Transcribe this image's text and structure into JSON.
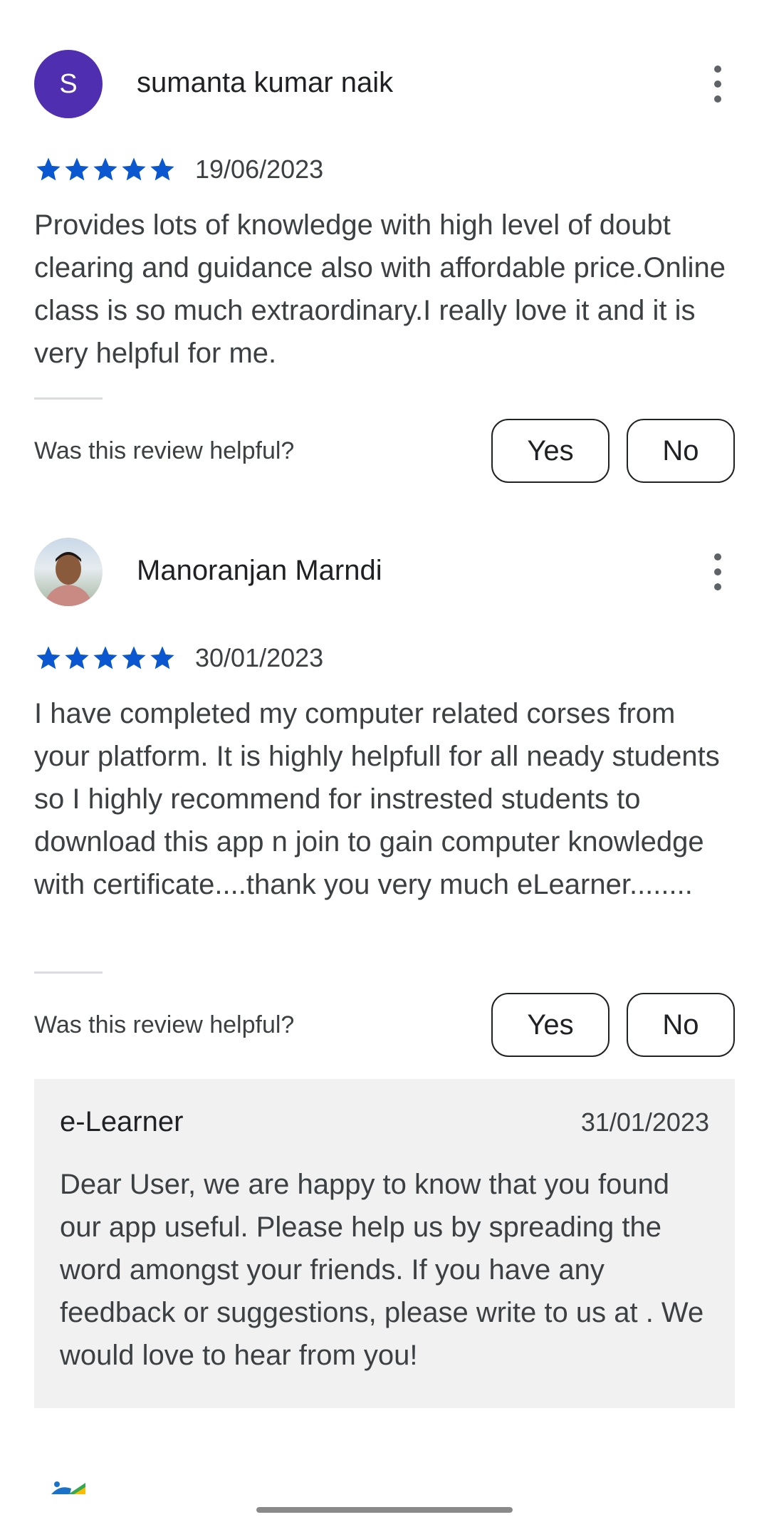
{
  "reviews": [
    {
      "avatar_letter": "S",
      "name": "sumanta kumar naik",
      "rating": 5,
      "date": "19/06/2023",
      "text": "Provides lots of knowledge with high level of doubt clearing and guidance also with affordable price.Online class is so much extraordinary.I really love it and it is very helpful for me.",
      "helpful_label": "Was this review helpful?",
      "yes_label": "Yes",
      "no_label": "No"
    },
    {
      "name": "Manoranjan Marndi",
      "rating": 5,
      "date": "30/01/2023",
      "text": "I have completed my computer related corses from your platform. It is highly helpfull for all neady students so I highly recommend for instrested students to download this app n join to gain computer knowledge with certificate....thank you very much eLearner........",
      "helpful_label": "Was this review helpful?",
      "yes_label": "Yes",
      "no_label": "No",
      "reply": {
        "author": "e-Learner",
        "date": "31/01/2023",
        "text": "Dear User, we are happy to know that you found our app useful. Please help us by spreading the word amongst your friends. If you have any feedback or suggestions, please write to us at . We would love to hear from you!"
      }
    }
  ],
  "colors": {
    "star": "#0b57d0",
    "avatar_bg": "#4f2fb0",
    "reply_bg": "#f1f1f1"
  }
}
